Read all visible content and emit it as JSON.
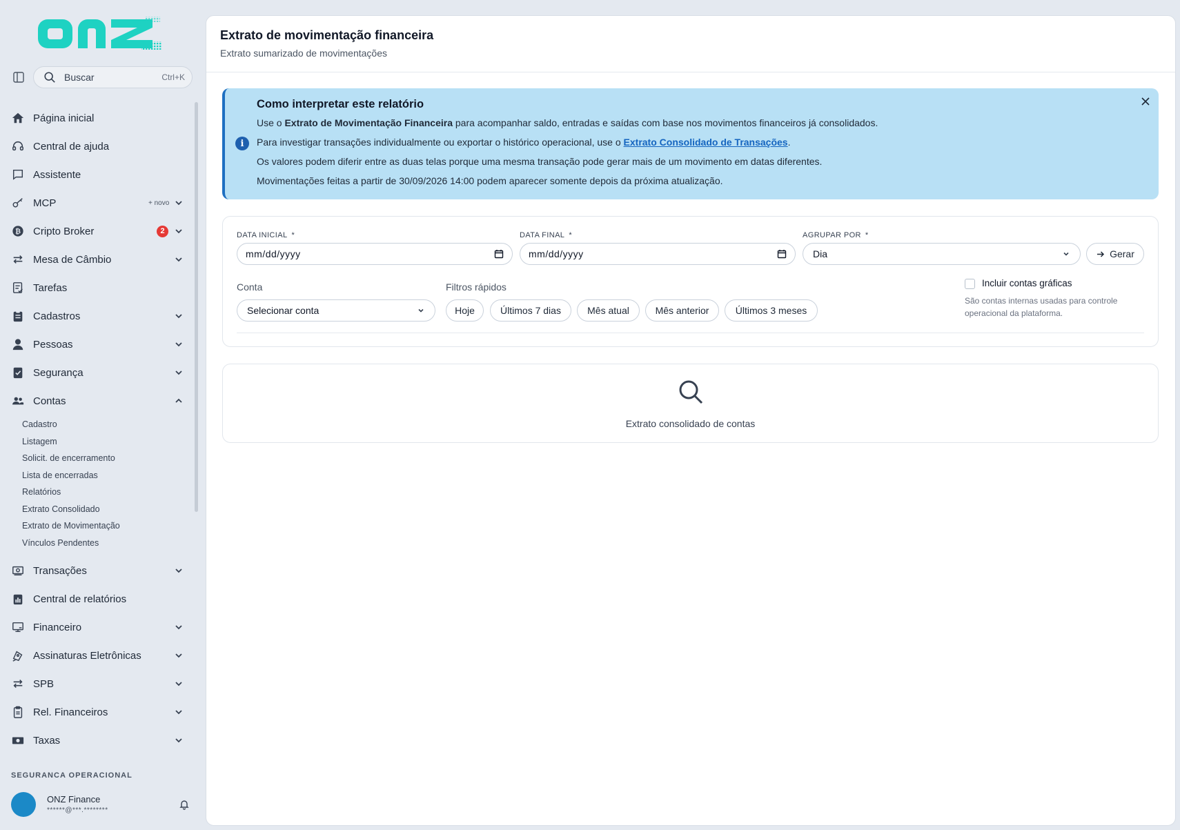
{
  "brand": {
    "logo_text": "onz",
    "logo_color": "#1ed2c2"
  },
  "search": {
    "label": "Buscar",
    "shortcut": "Ctrl+K"
  },
  "sidebar": {
    "items": [
      {
        "label": "Página inicial",
        "icon": "home-icon"
      },
      {
        "label": "Central de ajuda",
        "icon": "headset-icon"
      },
      {
        "label": "Assistente",
        "icon": "chat-icon"
      },
      {
        "label": "MCP",
        "icon": "key-icon",
        "tag": "+ novo"
      },
      {
        "label": "Cripto Broker",
        "icon": "bitcoin-icon",
        "badge": "2"
      },
      {
        "label": "Mesa de Câmbio",
        "icon": "exchange-icon"
      },
      {
        "label": "Tarefas",
        "icon": "tasks-icon"
      },
      {
        "label": "Cadastros",
        "icon": "clipboard-icon"
      },
      {
        "label": "Pessoas",
        "icon": "person-icon"
      },
      {
        "label": "Segurança",
        "icon": "shield-check-icon"
      },
      {
        "label": "Contas",
        "icon": "users-icon"
      },
      {
        "label": "Transações",
        "icon": "money-icon"
      },
      {
        "label": "Central de relatórios",
        "icon": "report-icon"
      },
      {
        "label": "Financeiro",
        "icon": "finance-icon"
      },
      {
        "label": "Assinaturas Eletrônicas",
        "icon": "signature-icon"
      },
      {
        "label": "SPB",
        "icon": "exchange-icon"
      },
      {
        "label": "Rel. Financeiros",
        "icon": "clipboard-doc-icon"
      },
      {
        "label": "Taxas",
        "icon": "cash-icon"
      }
    ],
    "contas_sub": [
      "Cadastro",
      "Listagem",
      "Solicit. de encerramento",
      "Lista de encerradas",
      "Relatórios",
      "Extrato Consolidado",
      "Extrato de Movimentação",
      "Vínculos Pendentes"
    ],
    "section_title": "SEGURANÇA OPERACIONAL"
  },
  "user": {
    "name": "ONZ Finance",
    "email": "******@***.********",
    "avatar_color": "#1b89c7"
  },
  "header": {
    "title": "Extrato de movimentação financeira",
    "subtitle": "Extrato sumarizado de movimentações"
  },
  "banner": {
    "title": "Como interpretar este relatório",
    "line1_pre": "Use o ",
    "line1_bold": "Extrato de Movimentação Financeira",
    "line1_post": " para acompanhar saldo, entradas e saídas com base nos movimentos financeiros já consolidados.",
    "line2_pre": "Para investigar transações individualmente ou exportar o histórico operacional, use o ",
    "line2_link": "Extrato Consolidado de Transações",
    "line2_post": ".",
    "line3": "Os valores podem diferir entre as duas telas porque uma mesma transação pode gerar mais de um movimento em datas diferentes.",
    "line4": "Movimentações feitas a partir de 30/09/2026 14:00 podem aparecer somente depois da próxima atualização.",
    "bg_color": "#b8e0f5"
  },
  "filters": {
    "date_start_label": "DATA INICIAL",
    "date_end_label": "DATA FINAL",
    "group_label": "AGRUPAR POR",
    "required_mark": "*",
    "date_placeholder": "mm/dd/yyyy",
    "group_value": "Dia",
    "generate_label": "Gerar",
    "account_label": "Conta",
    "account_placeholder": "Selecionar conta",
    "quick_label": "Filtros rápidos",
    "quick": [
      "Hoje",
      "Últimos 7 dias",
      "Mês atual",
      "Mês anterior",
      "Últimos 3 meses"
    ],
    "include_label": "Incluir contas gráficas",
    "include_checked": false,
    "include_help": "São contas internas usadas para controle operacional da plataforma."
  },
  "empty_state": {
    "text": "Extrato consolidado de contas"
  }
}
